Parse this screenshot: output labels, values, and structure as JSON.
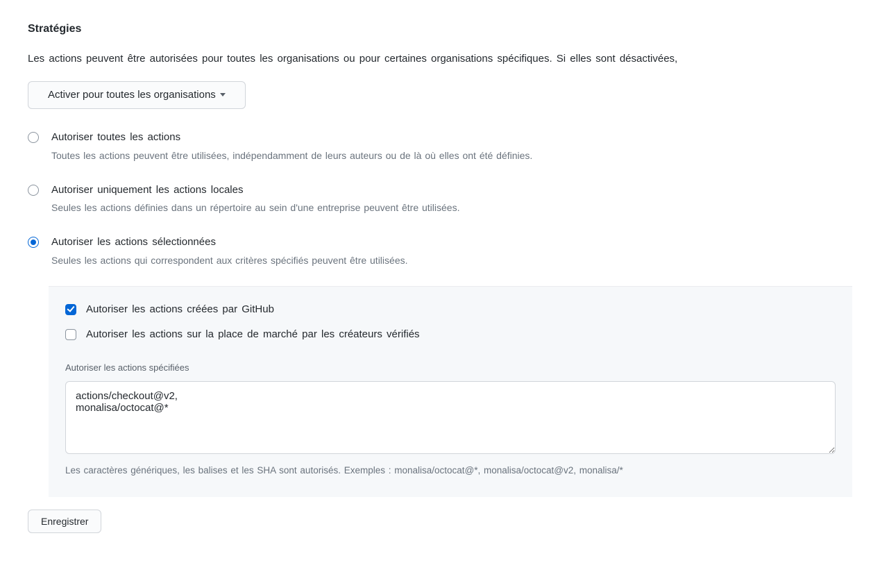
{
  "section_title": "Stratégies",
  "intro_text": "Les actions peuvent être autorisées pour toutes les organisations ou pour certaines organisations spécifiques. Si elles sont désactivées,",
  "enable_dropdown": {
    "label": "Activer pour toutes les organisations"
  },
  "radios": [
    {
      "title": "Autoriser toutes les actions",
      "desc": "Toutes les actions peuvent être utilisées, indépendamment de leurs auteurs ou de là où elles ont été définies.",
      "selected": false
    },
    {
      "title": "Autoriser uniquement les actions locales",
      "desc": "Seules les actions définies dans un répertoire au sein d'une entreprise peuvent être utilisées.",
      "selected": false
    },
    {
      "title": "Autoriser les actions sélectionnées",
      "desc": "Seules les actions qui correspondent aux critères spécifiés peuvent être utilisées.",
      "selected": true
    }
  ],
  "sub_panel": {
    "checkbox_github": {
      "label": "Autoriser les actions créées par GitHub",
      "checked": true
    },
    "checkbox_marketplace": {
      "label": "Autoriser les actions sur la place de marché par les créateurs vérifiés",
      "checked": false
    },
    "specified_label": "Autoriser les actions spécifiées",
    "textarea_value": "actions/checkout@v2,\nmonalisa/octocat@*",
    "hint": "Les caractères génériques, les balises et les SHA sont autorisés. Exemples : monalisa/octocat@*, monalisa/octocat@v2, monalisa/*"
  },
  "save_button": "Enregistrer"
}
